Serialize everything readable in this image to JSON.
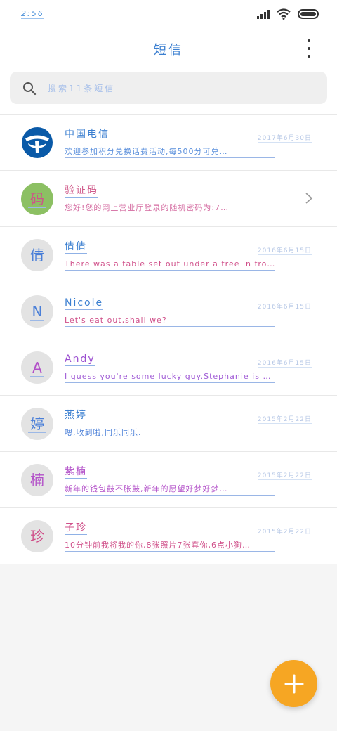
{
  "status_bar": {
    "time": "2:56"
  },
  "header": {
    "title": "短信"
  },
  "search": {
    "placeholder": "搜索11条短信"
  },
  "messages": [
    {
      "name": "中国电信",
      "date": "2017年6月30日",
      "preview": "欢迎参加积分兑换话费活动,每500分可兑…",
      "name_color": "#3b7fd0",
      "preview_color": "#5a8fdc"
    },
    {
      "name": "验证码",
      "date": "",
      "preview": "您好!您的网上营业厅登录的随机密码为:7…",
      "name_color": "#d05a8a",
      "preview_color": "#d46aa0"
    },
    {
      "name": "倩倩",
      "date": "2016年6月15日",
      "preview": "There was a table set out under a tree in fron…",
      "name_color": "#3b7fd0",
      "preview_color": "#d0508a"
    },
    {
      "name": "Nicole",
      "date": "2016年6月15日",
      "preview": "Let's eat out,shall we?",
      "name_color": "#3b7fd0",
      "preview_color": "#d0508a"
    },
    {
      "name": "Andy",
      "date": "2016年6月15日",
      "preview": "I guess you're some lucky guy.Stephanie is a n…",
      "name_color": "#9b4fd0",
      "preview_color": "#a05bd6"
    },
    {
      "name": "燕婷",
      "date": "2015年2月22日",
      "preview": "嗯,收到啦,同乐同乐.",
      "name_color": "#3b7fd0",
      "preview_color": "#4a7fd8"
    },
    {
      "name": "紫楠",
      "date": "2015年2月22日",
      "preview": "新年的钱包鼓不胀鼓,新年的愿望好梦好梦…",
      "name_color": "#b24fc8",
      "preview_color": "#b24fc8"
    },
    {
      "name": "子珍",
      "date": "2015年2月22日",
      "preview": "10分钟前我将我的你,8张照片7张真你,6点小狗…",
      "name_color": "#d0508a",
      "preview_color": "#d0508a"
    }
  ],
  "avatars": {
    "row2": "码",
    "row3": "倩",
    "row4": "N",
    "row5": "A",
    "row6": "婷",
    "row7": "楠",
    "row8": "珍"
  },
  "colors": {
    "accent": "#f6a623",
    "logo_blue": "#0a5aa8",
    "avatar_green": "#8cc063"
  }
}
